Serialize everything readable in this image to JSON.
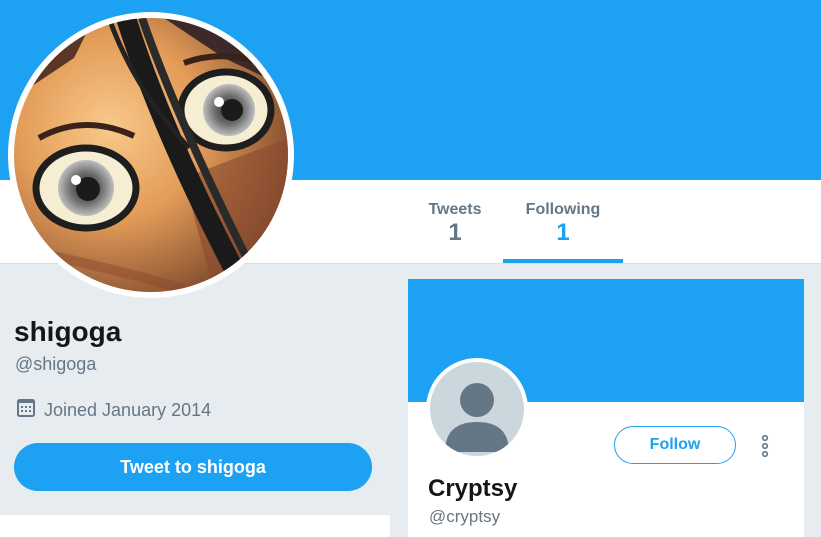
{
  "colors": {
    "accent": "#1da1f2",
    "banner": "#1da1f2",
    "page_bg": "#e6ecf0",
    "text_primary": "#14171a",
    "text_secondary": "#657786",
    "placeholder_avatar": "#ccd6dd"
  },
  "profile": {
    "name": "shigoga",
    "handle": "@shigoga",
    "joined": "Joined January 2014",
    "joined_icon": "calendar-icon",
    "tweet_to_label": "Tweet to shigoga",
    "avatar": "anime-eyes-avatar"
  },
  "nav": {
    "tabs": [
      {
        "label": "Tweets",
        "value": "1",
        "active": false
      },
      {
        "label": "Following",
        "value": "1",
        "active": true
      }
    ]
  },
  "following": {
    "cards": [
      {
        "name": "Cryptsy",
        "handle": "@cryptsy",
        "follow_label": "Follow",
        "avatar": "default-user-avatar",
        "more_icon": "vertical-dots-icon"
      }
    ]
  }
}
